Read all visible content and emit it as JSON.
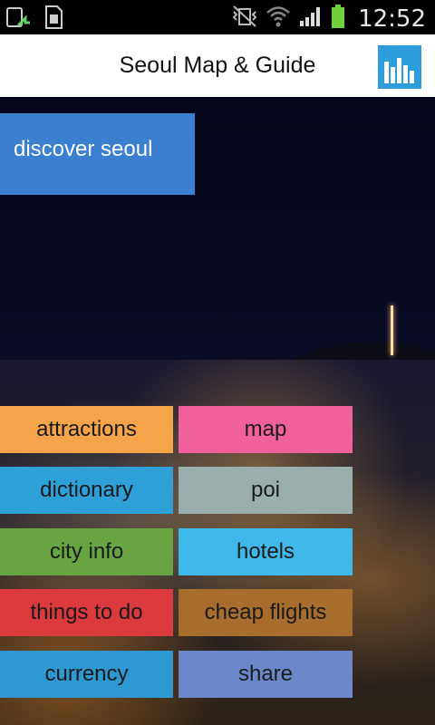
{
  "status_bar": {
    "time": "12:52",
    "left_icons": [
      "upload-icon",
      "sd-card-icon"
    ],
    "right_icons": [
      "vibrate-mute-icon",
      "wifi-icon",
      "signal-icon",
      "battery-icon"
    ]
  },
  "header": {
    "title": "Seoul Map & Guide",
    "chart_button_icon": "bar-chart-icon"
  },
  "discover": {
    "label": "discover seoul",
    "color": "#3b7fd1"
  },
  "menu": [
    {
      "label": "attractions",
      "color": "#f6a44a"
    },
    {
      "label": "map",
      "color": "#f0609a"
    },
    {
      "label": "dictionary",
      "color": "#2f9fd8"
    },
    {
      "label": "poi",
      "color": "#9aaeae"
    },
    {
      "label": "city info",
      "color": "#66a542"
    },
    {
      "label": "hotels",
      "color": "#3fb8ea"
    },
    {
      "label": "things to do",
      "color": "#db3a3c"
    },
    {
      "label": "cheap flights",
      "color": "#a86d2c"
    },
    {
      "label": "currency",
      "color": "#2e98d3"
    },
    {
      "label": "share",
      "color": "#6c87c9"
    }
  ]
}
